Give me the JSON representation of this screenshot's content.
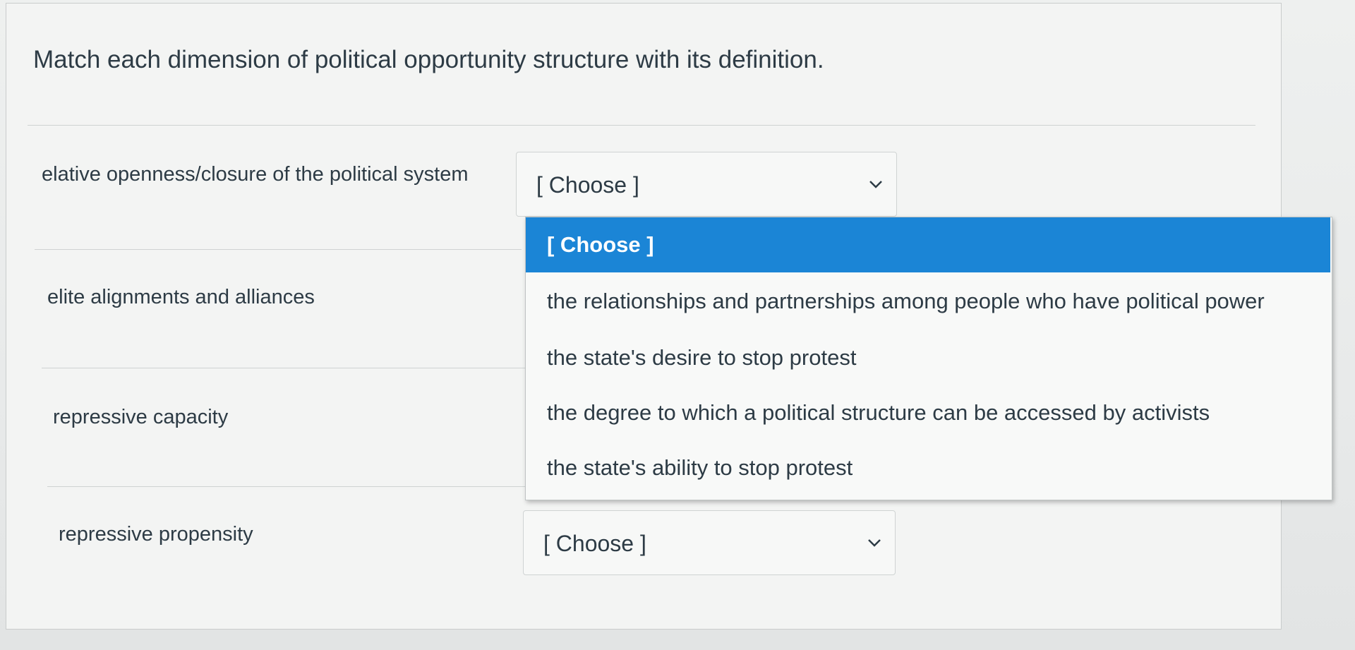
{
  "question": {
    "text": "Match each dimension of political opportunity structure with its definition."
  },
  "rows": [
    {
      "label": "elative openness/closure of the political system",
      "select_value": "[ Choose ]"
    },
    {
      "label": "elite alignments and alliances"
    },
    {
      "label": "repressive capacity"
    },
    {
      "label": "repressive propensity",
      "select_value": "[ Choose ]"
    }
  ],
  "dropdown": {
    "options": [
      "[ Choose ]",
      "the relationships and partnerships among people who have political power",
      "the state's desire to stop protest",
      "the degree to which a political structure can be accessed by activists",
      "the state's ability to stop protest"
    ],
    "highlighted_index": 0
  },
  "colors": {
    "highlight": "#1b85d6",
    "text": "#2d3b45"
  },
  "icons": {
    "select_chevron": "chevron-down-icon"
  }
}
